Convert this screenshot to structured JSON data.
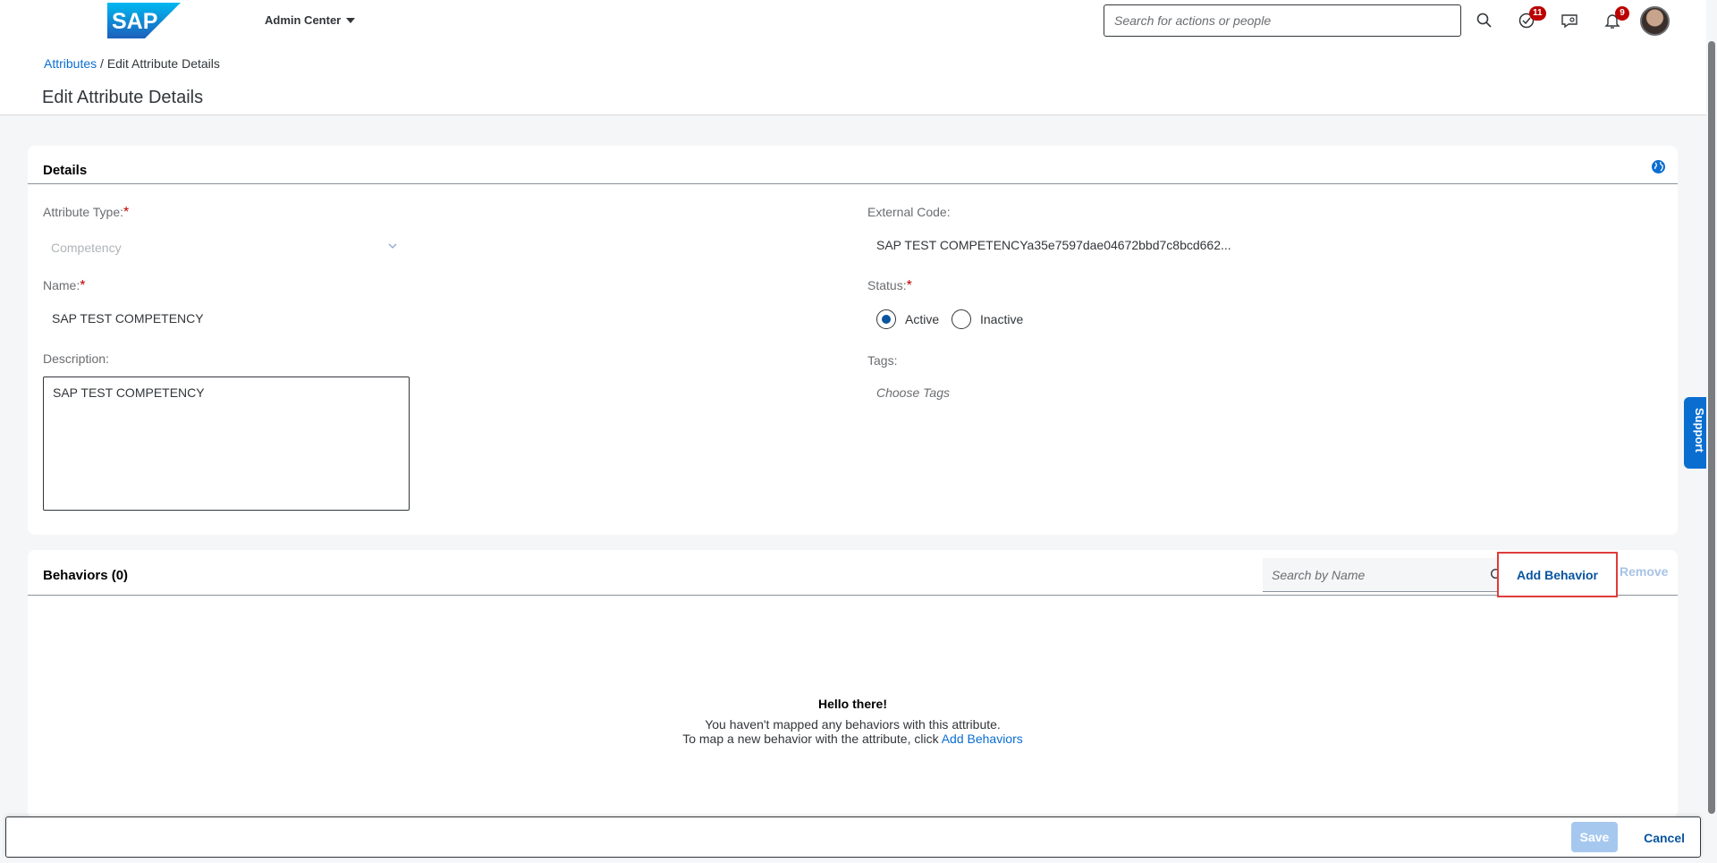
{
  "header": {
    "logo_text": "SAP",
    "app_menu": "Admin Center",
    "search_placeholder": "Search for actions or people",
    "todo_badge": "11",
    "notification_badge": "9"
  },
  "breadcrumb": {
    "link": "Attributes",
    "separator": " / ",
    "current": "Edit Attribute Details"
  },
  "page_title": "Edit Attribute Details",
  "details": {
    "title": "Details",
    "attribute_type_label": "Attribute Type:",
    "attribute_type_value": "Competency",
    "required_mark": "*",
    "name_label": "Name:",
    "name_value": "SAP TEST COMPETENCY",
    "description_label": "Description:",
    "description_value": "SAP TEST COMPETENCY",
    "external_code_label": "External Code:",
    "external_code_value": "SAP TEST COMPETENCYa35e7597dae04672bbd7c8bcd662...",
    "status_label": "Status:",
    "status_options": [
      "Active",
      "Inactive"
    ],
    "status_selected": "Active",
    "tags_label": "Tags:",
    "tags_placeholder": "Choose Tags"
  },
  "behaviors": {
    "title": "Behaviors (0)",
    "search_placeholder": "Search by Name",
    "add_label": "Add Behavior",
    "remove_label": "Remove",
    "empty_title": "Hello there!",
    "empty_line1": "You haven't mapped any behaviors with this attribute.",
    "empty_line2_prefix": "To map a new behavior with the attribute, click ",
    "empty_line2_link": "Add Behaviors"
  },
  "footer": {
    "save_label": "Save",
    "cancel_label": "Cancel"
  },
  "support_label": "Support",
  "colors": {
    "brand_blue": "#0854a0",
    "link_blue": "#0a6ed1",
    "required_red": "#bb0000",
    "highlight_red": "#e03b3b",
    "badge_red": "#bb0000"
  }
}
